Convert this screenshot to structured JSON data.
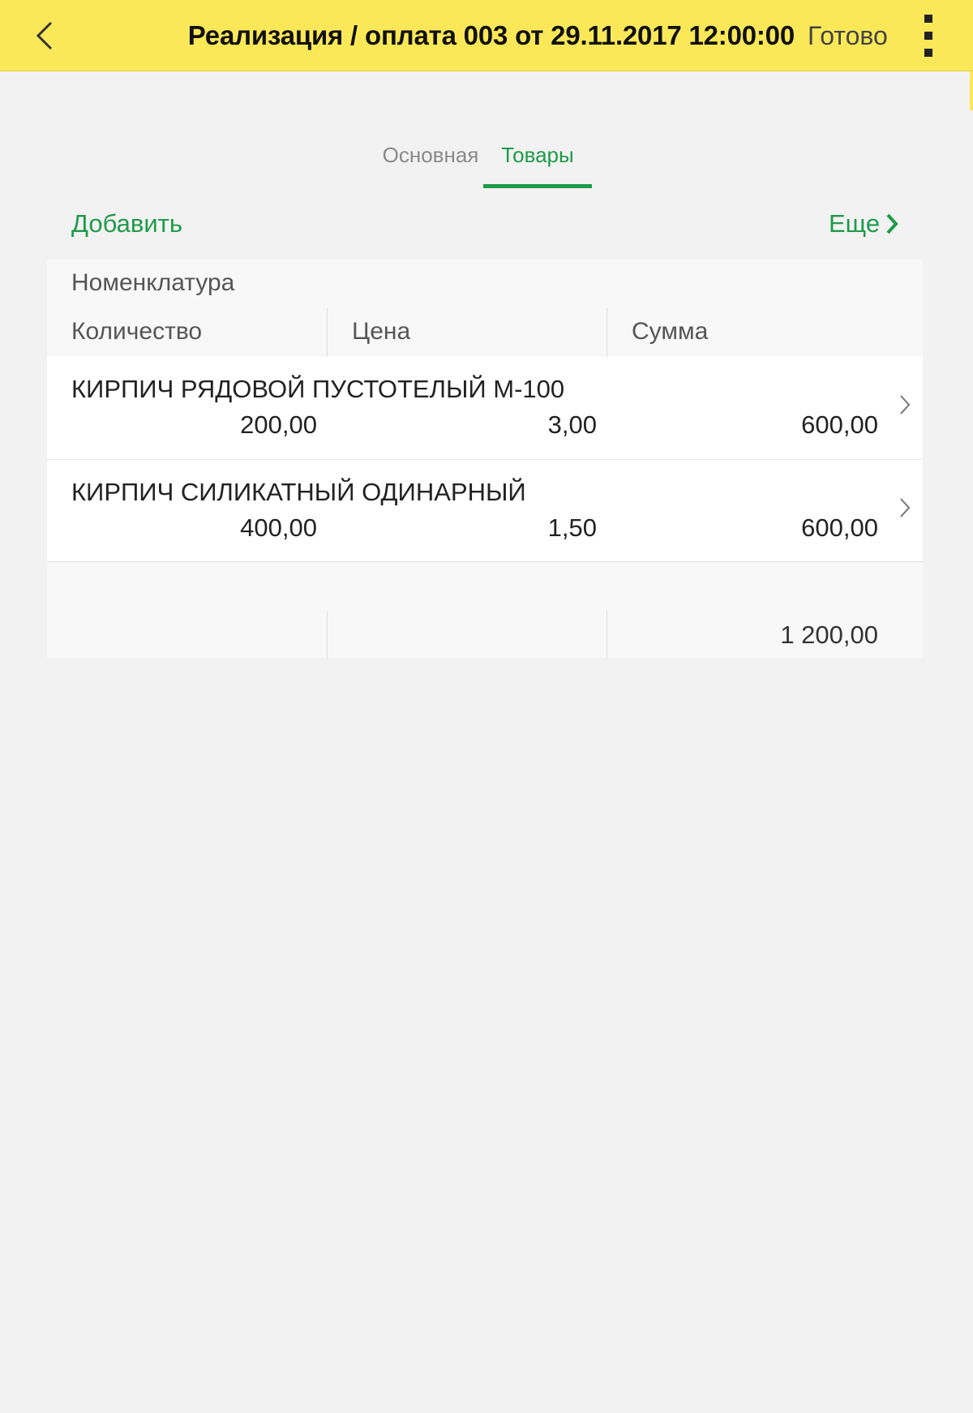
{
  "header": {
    "title": "Реализация / оплата 003 от 29.11.2017 12:00:00",
    "done_label": "Готово",
    "accent_color": "#fbe858"
  },
  "tabs": [
    {
      "label": "Основная",
      "active": false
    },
    {
      "label": "Товары",
      "active": true
    }
  ],
  "toolbar": {
    "add_label": "Добавить",
    "more_label": "Еще"
  },
  "table": {
    "header_nomenclature": "Номенклатура",
    "columns": [
      "Количество",
      "Цена",
      "Сумма"
    ],
    "rows": [
      {
        "name": "КИРПИЧ РЯДОВОЙ ПУСТОТЕЛЫЙ М-100",
        "qty": "200,00",
        "price": "3,00",
        "sum": "600,00"
      },
      {
        "name": "КИРПИЧ СИЛИКАТНЫЙ ОДИНАРНЫЙ",
        "qty": "400,00",
        "price": "1,50",
        "sum": "600,00"
      }
    ],
    "total_sum": "1 200,00"
  },
  "icons": {
    "back": "chevron-left-icon",
    "menu": "more-vertical-icon",
    "more": "chevron-right-icon",
    "row": "chevron-right-icon"
  },
  "colors": {
    "green": "#1f9a4a",
    "background": "#f2f2f2"
  }
}
